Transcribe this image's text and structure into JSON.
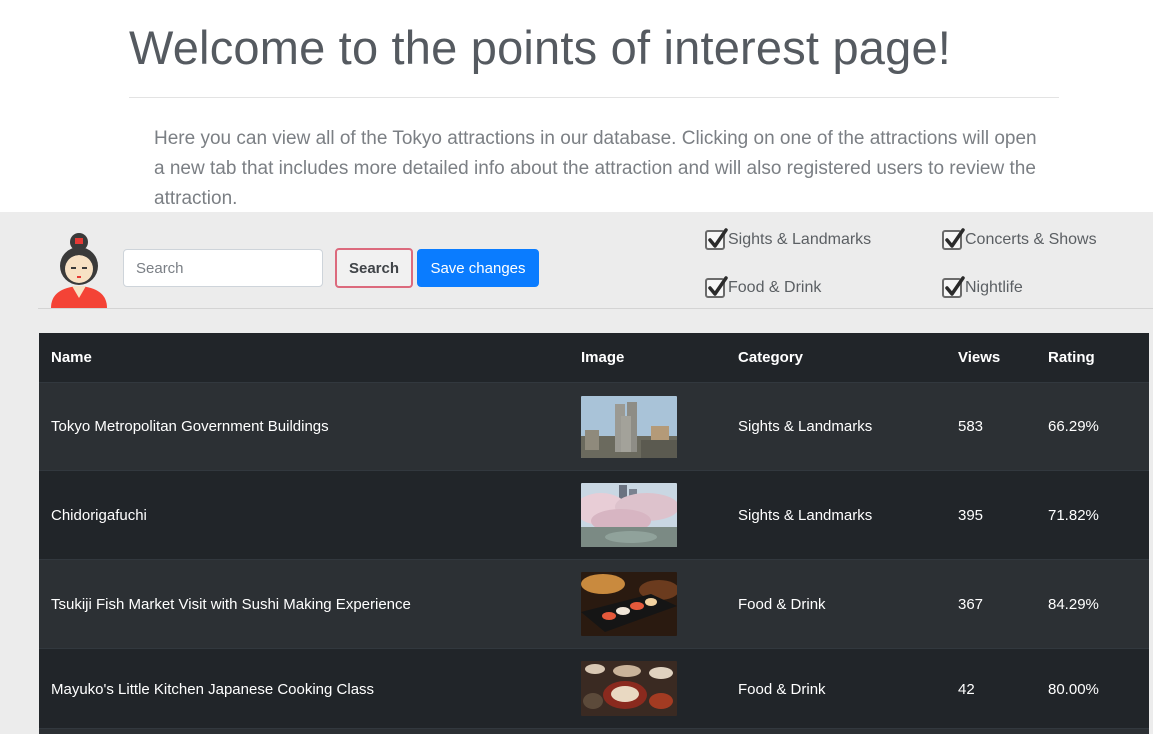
{
  "header": {
    "title": "Welcome to the points of interest page!",
    "intro": "Here you can view all of the Tokyo attractions in our database. Clicking on one of the attractions will open a new tab that includes more detailed info about the attraction and will also registered users to review the attraction."
  },
  "toolbar": {
    "search_placeholder": "Search",
    "search_label": "Search",
    "save_label": "Save changes",
    "filters": [
      {
        "label": "Sights & Landmarks",
        "checked": true
      },
      {
        "label": "Concerts & Shows",
        "checked": true
      },
      {
        "label": "Food & Drink",
        "checked": true
      },
      {
        "label": "Nightlife",
        "checked": true
      }
    ]
  },
  "table": {
    "columns": [
      "Name",
      "Image",
      "Category",
      "Views",
      "Rating"
    ],
    "rows": [
      {
        "name": "Tokyo Metropolitan Government Buildings",
        "category": "Sights & Landmarks",
        "views": "583",
        "rating": "66.29%",
        "image": "city-towers"
      },
      {
        "name": "Chidorigafuchi",
        "category": "Sights & Landmarks",
        "views": "395",
        "rating": "71.82%",
        "image": "cherry-blossom-moat"
      },
      {
        "name": "Tsukiji Fish Market Visit with Sushi Making Experience",
        "category": "Food & Drink",
        "views": "367",
        "rating": "84.29%",
        "image": "sushi-plate"
      },
      {
        "name": "Mayuko's Little Kitchen Japanese Cooking Class",
        "category": "Food & Drink",
        "views": "42",
        "rating": "80.00%",
        "image": "dinner-table"
      }
    ]
  },
  "colors": {
    "primary": "#0a7cff",
    "search_border": "#dc6a7d",
    "table_dark": "#212529",
    "table_stripe": "#2c3034"
  }
}
